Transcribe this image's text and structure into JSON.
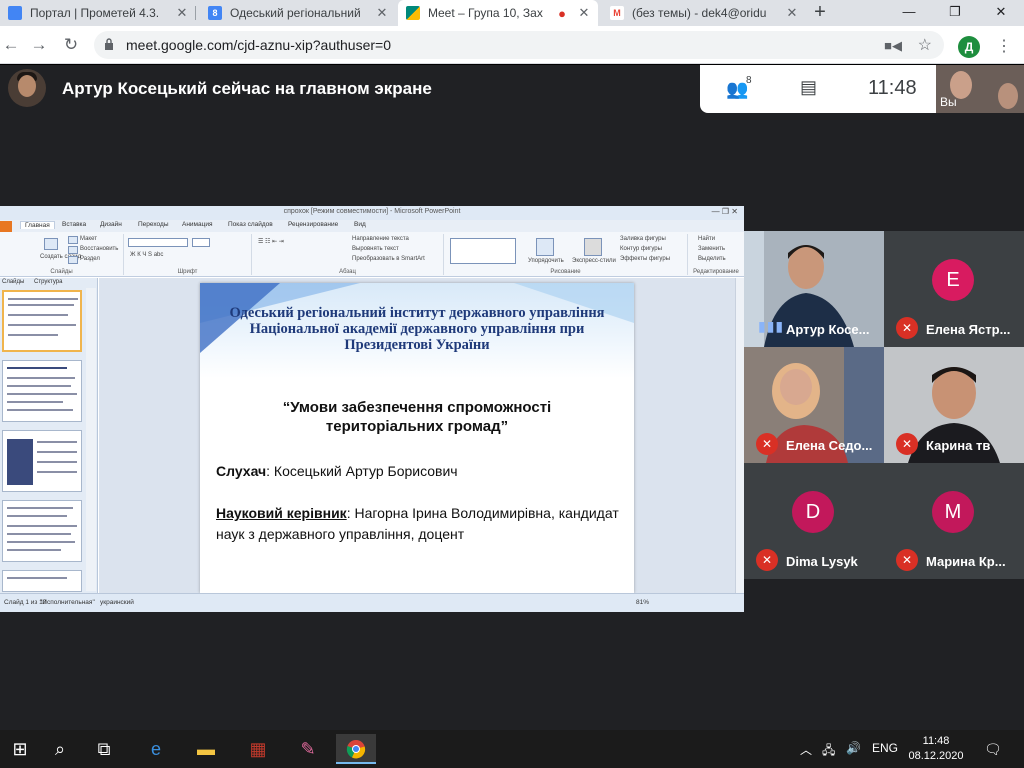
{
  "browser": {
    "tabs": [
      {
        "title": "Портал | Прометей 4.3.",
        "favicon_color": "#4285f4",
        "favicon_letter": ""
      },
      {
        "title": "Одеський регіональний",
        "favicon_color": "#4285f4",
        "favicon_letter": "8"
      },
      {
        "title": "Meet – Група 10, Зах",
        "favicon_color": "#00897b",
        "favicon_letter": ""
      },
      {
        "title": "(без темы) - dek4@oridu",
        "favicon_color": "#ea4335",
        "favicon_letter": "M"
      }
    ],
    "url": "meet.google.com/cjd-aznu-xip?authuser=0",
    "profile_initial": "Д"
  },
  "meet": {
    "presenter_title": "Артур Косецький сейчас на главном экране",
    "participant_count": "8",
    "time": "11:48",
    "self_label": "Вы",
    "participants": [
      {
        "name": "Артур Косе...",
        "initial": "",
        "muted": false,
        "video": true
      },
      {
        "name": "Елена Ястр...",
        "initial": "E",
        "muted": true,
        "video": false,
        "color": "#d81b60"
      },
      {
        "name": "Елена Седо...",
        "initial": "",
        "muted": true,
        "video": true
      },
      {
        "name": "Карина тв",
        "initial": "",
        "muted": true,
        "video": true
      },
      {
        "name": "Dima Lysyk",
        "initial": "D",
        "muted": true,
        "video": false,
        "color": "#c2185b"
      },
      {
        "name": "Марина Кр...",
        "initial": "M",
        "muted": true,
        "video": false,
        "color": "#c2185b"
      }
    ]
  },
  "powerpoint": {
    "window_title": "спрохок [Режим совместимости] - Microsoft PowerPoint",
    "tabs": [
      "Главная",
      "Вставка",
      "Дизайн",
      "Переходы",
      "Анимация",
      "Показ слайдов",
      "Рецензирование",
      "Вид"
    ],
    "groups": [
      "Слайды",
      "Шрифт",
      "Абзац",
      "Рисование",
      "Редактирование"
    ],
    "ribbon_items": {
      "layout": "Макет",
      "reset": "Восстановить",
      "section": "Раздел",
      "create_slide": "Создать слайд",
      "text_dir": "Направление текста",
      "align_text": "Выровнять текст",
      "smartart": "Преобразовать в SmartArt",
      "arrange": "Упорядочить",
      "quick_styles": "Экспресс-стили",
      "fill": "Заливка фигуры",
      "outline": "Контур фигуры",
      "effects": "Эффекты фигуры",
      "find": "Найти",
      "replace": "Заменить",
      "select": "Выделить"
    },
    "outline_tabs": [
      "Слайды",
      "Структура"
    ],
    "status": {
      "slide": "Слайд 1 из 10",
      "theme": "\"Исполнительная\"",
      "lang": "украинский",
      "zoom": "81%"
    },
    "slide": {
      "institution": "Одеський регіональний інститут державного управління Національної академії державного управління при Президентові України",
      "topic": "“Умови забезпечення спроможності територіальних громад”",
      "listener_label": "Слухач",
      "listener_name": ": Косецький Артур Борисович",
      "supervisor_label": "Науковий керівник",
      "supervisor_name": ": Нагорна Ірина Володимирівна, кандидат наук з державного управління, доцент"
    }
  },
  "taskbar": {
    "lang": "ENG",
    "time": "11:48",
    "date": "08.12.2020"
  }
}
